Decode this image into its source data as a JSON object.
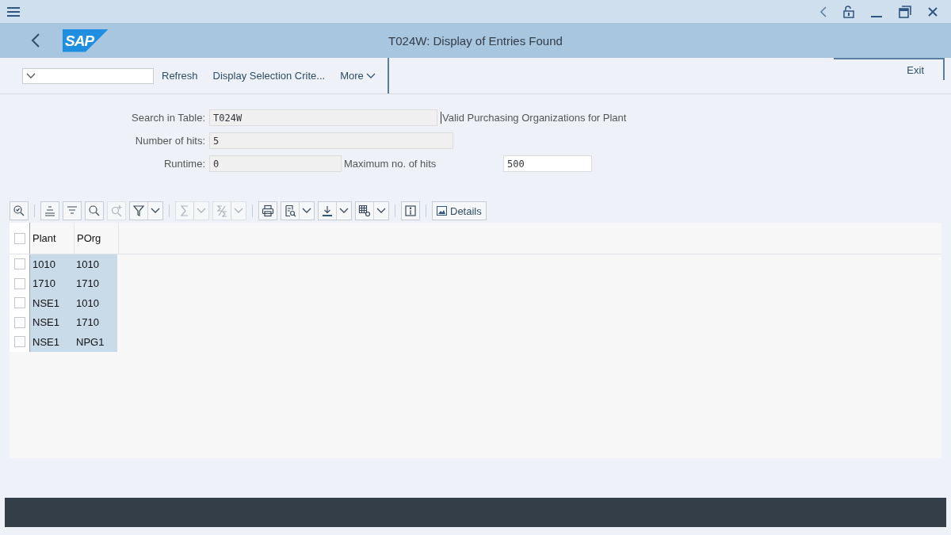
{
  "window": {
    "title": "T024W: Display of Entries Found"
  },
  "header": {
    "logo": "SAP"
  },
  "app_toolbar": {
    "buttons": [
      {
        "label": "Refresh",
        "kind": "plain"
      },
      {
        "label": "Display Selection Crite...",
        "kind": "plain"
      },
      {
        "label": "More",
        "kind": "menu"
      }
    ],
    "exit": "Exit"
  },
  "form": {
    "rows": [
      {
        "label": "Search in Table:",
        "value": "T024W",
        "kind": "wide",
        "description": "Valid Purchasing Organizations for Plant"
      },
      {
        "label": "Number of hits:",
        "value": "5",
        "kind": "wider"
      },
      {
        "label": "Runtime:",
        "value": "0",
        "kind": "short",
        "extra_label": "Maximum no. of hits",
        "extra_value": "500"
      }
    ]
  },
  "grid_toolbar": [
    [
      {
        "kind": "zoom",
        "disabled": false,
        "dropdown": false
      }
    ],
    [
      {
        "kind": "sort-asc",
        "disabled": false,
        "dropdown": false
      },
      {
        "kind": "sort-desc",
        "disabled": false,
        "dropdown": false
      },
      {
        "kind": "find",
        "disabled": false,
        "dropdown": false
      },
      {
        "kind": "find-next",
        "disabled": true,
        "dropdown": false
      },
      {
        "kind": "filter",
        "disabled": false,
        "dropdown": true
      }
    ],
    [
      {
        "kind": "sum",
        "disabled": true,
        "dropdown": true
      },
      {
        "kind": "subtotal",
        "disabled": true,
        "dropdown": true
      }
    ],
    [
      {
        "kind": "print",
        "disabled": false,
        "dropdown": false
      },
      {
        "kind": "preview",
        "disabled": false,
        "dropdown": true
      },
      {
        "kind": "export",
        "disabled": false,
        "dropdown": true
      },
      {
        "kind": "layout",
        "disabled": false,
        "dropdown": true
      }
    ],
    [
      {
        "kind": "info",
        "disabled": false,
        "dropdown": false
      }
    ]
  ],
  "details_button": "Details",
  "table": {
    "columns": [
      "Plant",
      "POrg"
    ],
    "select_all_checked": false,
    "rows": [
      {
        "checked": false,
        "cells": [
          "1010",
          "1010"
        ]
      },
      {
        "checked": false,
        "cells": [
          "1710",
          "1710"
        ]
      },
      {
        "checked": false,
        "cells": [
          "NSE1",
          "1010"
        ]
      },
      {
        "checked": false,
        "cells": [
          "NSE1",
          "1710"
        ]
      },
      {
        "checked": false,
        "cells": [
          "NSE1",
          "NPG1"
        ]
      }
    ]
  }
}
